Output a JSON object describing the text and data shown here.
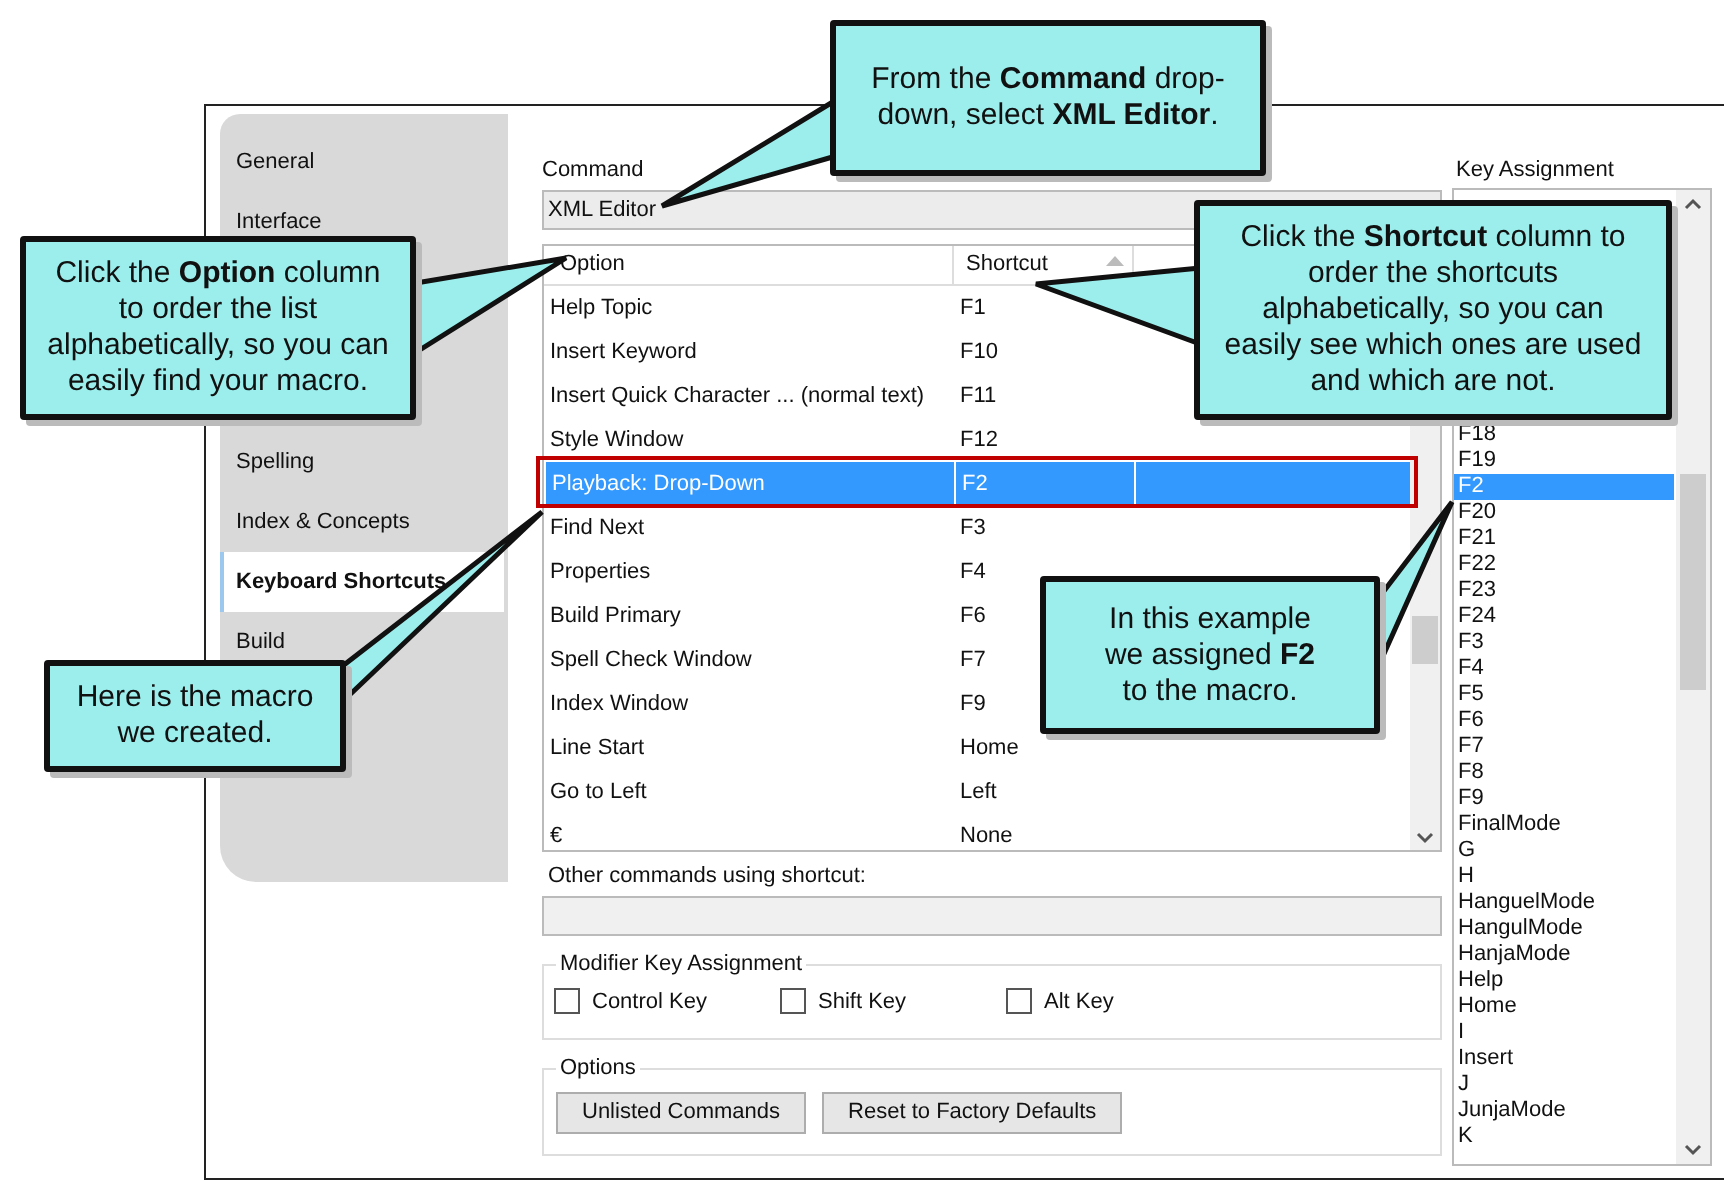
{
  "sidebar": {
    "items": [
      {
        "label": "General",
        "selected": false
      },
      {
        "label": "Interface",
        "selected": false
      },
      {
        "label": "Spelling",
        "selected": false
      },
      {
        "label": "Index & Concepts",
        "selected": false
      },
      {
        "label": "Keyboard Shortcuts",
        "selected": true
      },
      {
        "label": "Build",
        "selected": false
      }
    ]
  },
  "command": {
    "label": "Command",
    "value": "XML Editor"
  },
  "table": {
    "columns": [
      {
        "label": "Option",
        "sorted": false
      },
      {
        "label": "Shortcut",
        "sorted": true
      }
    ],
    "rows": [
      {
        "option": "Help Topic",
        "shortcut": "F1",
        "selected": false,
        "outlined": false
      },
      {
        "option": "Insert Keyword",
        "shortcut": "F10",
        "selected": false,
        "outlined": false
      },
      {
        "option": "Insert Quick Character ... (normal text)",
        "shortcut": "F11",
        "selected": false,
        "outlined": false
      },
      {
        "option": "Style Window",
        "shortcut": "F12",
        "selected": false,
        "outlined": false
      },
      {
        "option": "Playback: Drop-Down",
        "shortcut": "F2",
        "selected": true,
        "outlined": true
      },
      {
        "option": "Find Next",
        "shortcut": "F3",
        "selected": false,
        "outlined": false
      },
      {
        "option": "Properties",
        "shortcut": "F4",
        "selected": false,
        "outlined": false
      },
      {
        "option": "Build Primary",
        "shortcut": "F6",
        "selected": false,
        "outlined": false
      },
      {
        "option": "Spell Check Window",
        "shortcut": "F7",
        "selected": false,
        "outlined": false
      },
      {
        "option": "Index Window",
        "shortcut": "F9",
        "selected": false,
        "outlined": false
      },
      {
        "option": "Line Start",
        "shortcut": "Home",
        "selected": false,
        "outlined": false
      },
      {
        "option": "Go to Left",
        "shortcut": "Left",
        "selected": false,
        "outlined": false
      },
      {
        "option": "€",
        "shortcut": "None",
        "selected": false,
        "outlined": false
      }
    ]
  },
  "other_commands": {
    "label": "Other commands using shortcut:"
  },
  "modifier": {
    "title": "Modifier Key Assignment",
    "keys": [
      {
        "label": "Control Key",
        "checked": false
      },
      {
        "label": "Shift Key",
        "checked": false
      },
      {
        "label": "Alt Key",
        "checked": false
      }
    ]
  },
  "options": {
    "title": "Options",
    "buttons": [
      "Unlisted Commands",
      "Reset to Factory Defaults"
    ]
  },
  "key_assignment": {
    "label": "Key Assignment",
    "items": [
      {
        "label": "F18",
        "selected": false
      },
      {
        "label": "F19",
        "selected": false
      },
      {
        "label": "F2",
        "selected": true
      },
      {
        "label": "F20",
        "selected": false
      },
      {
        "label": "F21",
        "selected": false
      },
      {
        "label": "F22",
        "selected": false
      },
      {
        "label": "F23",
        "selected": false
      },
      {
        "label": "F24",
        "selected": false
      },
      {
        "label": "F3",
        "selected": false
      },
      {
        "label": "F4",
        "selected": false
      },
      {
        "label": "F5",
        "selected": false
      },
      {
        "label": "F6",
        "selected": false
      },
      {
        "label": "F7",
        "selected": false
      },
      {
        "label": "F8",
        "selected": false
      },
      {
        "label": "F9",
        "selected": false
      },
      {
        "label": "FinalMode",
        "selected": false
      },
      {
        "label": "G",
        "selected": false
      },
      {
        "label": "H",
        "selected": false
      },
      {
        "label": "HanguelMode",
        "selected": false
      },
      {
        "label": "HangulMode",
        "selected": false
      },
      {
        "label": "HanjaMode",
        "selected": false
      },
      {
        "label": "Help",
        "selected": false
      },
      {
        "label": "Home",
        "selected": false
      },
      {
        "label": "I",
        "selected": false
      },
      {
        "label": "Insert",
        "selected": false
      },
      {
        "label": "J",
        "selected": false
      },
      {
        "label": "JunjaMode",
        "selected": false
      },
      {
        "label": "K",
        "selected": false
      }
    ]
  },
  "callouts": [
    {
      "text": "From the **Command** drop-down, select **XML Editor**."
    },
    {
      "text": "Click the **Option** column to order the list alphabetically, so you can easily find your macro."
    },
    {
      "text": "Click the **Shortcut** column to order the shortcuts alphabetically, so you can easily see which ones are used and which are not."
    },
    {
      "text": "Here is the macro we created."
    },
    {
      "text": "In this example we assigned **F2** to the macro."
    }
  ]
}
